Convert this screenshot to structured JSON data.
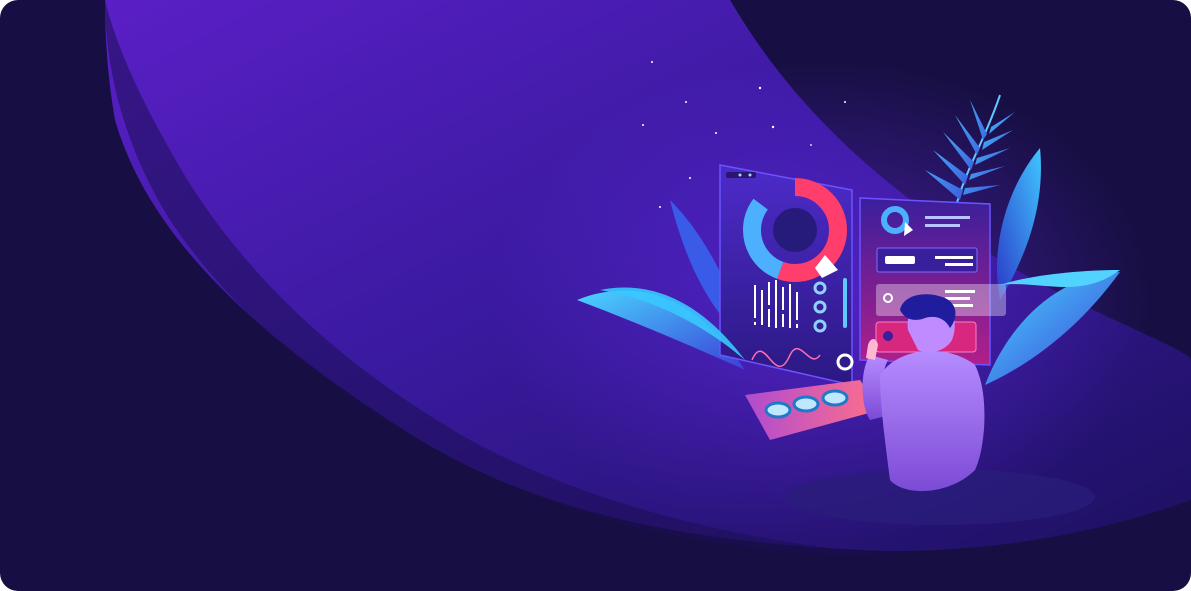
{
  "hero": {
    "theme": "dark-purple",
    "colors": {
      "background": "#170f43",
      "wave": "#3a1aa8",
      "accent_blue": "#3fb0ff",
      "accent_pink": "#e0327a",
      "accent_purple": "#8a3cff"
    },
    "illustration": {
      "icon": "analytics-dashboard-illustration"
    }
  }
}
